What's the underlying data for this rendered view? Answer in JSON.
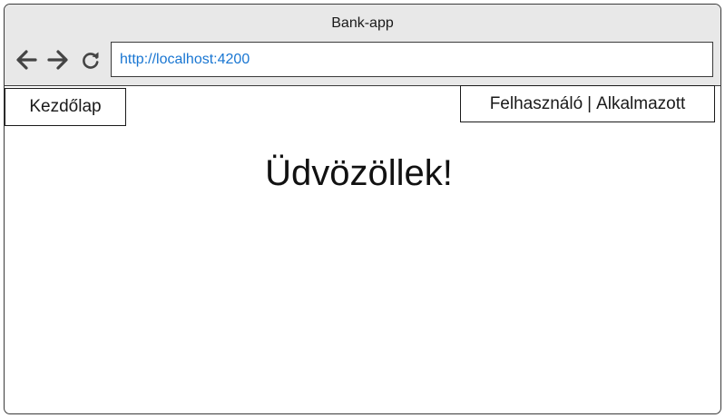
{
  "window": {
    "title": "Bank-app"
  },
  "toolbar": {
    "back_icon": "arrow-left-icon",
    "forward_icon": "arrow-right-icon",
    "reload_icon": "reload-icon",
    "address": "http://localhost:4200",
    "address_color": "#1976d2"
  },
  "nav": {
    "home_label": "Kezdőlap",
    "user_label": "Felhasználó",
    "separator": "|",
    "employee_label": "Alkalmazott"
  },
  "main": {
    "welcome_text": "Üdvözöllek!"
  }
}
